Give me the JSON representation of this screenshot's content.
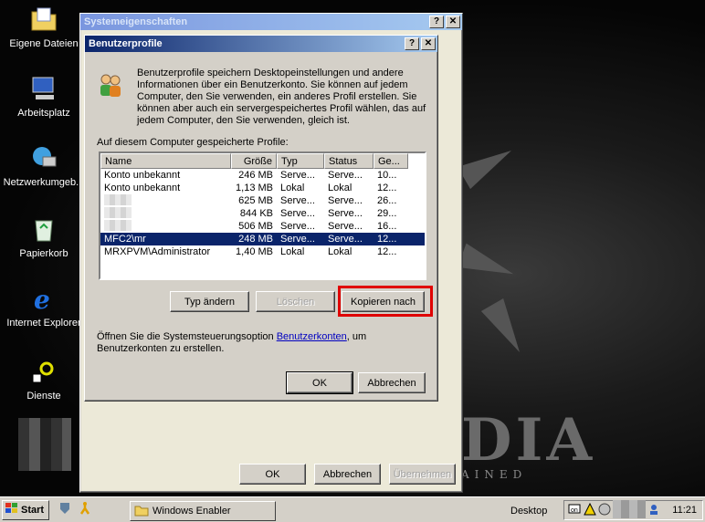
{
  "desktop": {
    "icons": [
      {
        "label": "Eigene Dateien",
        "icon": "folder-documents-icon"
      },
      {
        "label": "Arbeitsplatz",
        "icon": "my-computer-icon"
      },
      {
        "label": "Netzwerkumgeb...",
        "icon": "network-icon"
      },
      {
        "label": "Papierkorb",
        "icon": "recycle-bin-icon"
      },
      {
        "label": "Internet Explorer",
        "icon": "internet-explorer-icon"
      },
      {
        "label": "Dienste",
        "icon": "services-icon"
      }
    ],
    "wallpaper_text": "DIA",
    "wallpaper_sub": "AINED"
  },
  "outer_window": {
    "title": "Systemeigenschaften",
    "buttons": {
      "ok": "OK",
      "cancel": "Abbrechen",
      "apply": "Übernehmen"
    }
  },
  "dialog": {
    "title": "Benutzerprofile",
    "info_text": "Benutzerprofile speichern Desktopeinstellungen und andere Informationen über ein Benutzerkonto. Sie können auf jedem Computer, den Sie verwenden, ein anderes Profil erstellen. Sie können aber auch ein servergespeichertes Profil wählen, das auf jedem Computer, den Sie verwenden, gleich ist.",
    "list_label": "Auf diesem Computer gespeicherte Profile:",
    "columns": [
      "Name",
      "Größe",
      "Typ",
      "Status",
      "Ge..."
    ],
    "rows": [
      {
        "name": "Konto unbekannt",
        "size": "246 MB",
        "typ": "Serve...",
        "status": "Serve...",
        "ge": "10...",
        "blurred": false,
        "selected": false
      },
      {
        "name": "Konto unbekannt",
        "size": "1,13 MB",
        "typ": "Lokal",
        "status": "Lokal",
        "ge": "12...",
        "blurred": false,
        "selected": false
      },
      {
        "name": "",
        "size": "625 MB",
        "typ": "Serve...",
        "status": "Serve...",
        "ge": "26...",
        "blurred": true,
        "selected": false
      },
      {
        "name": "",
        "size": "844 KB",
        "typ": "Serve...",
        "status": "Serve...",
        "ge": "29...",
        "blurred": true,
        "selected": false
      },
      {
        "name": "",
        "size": "506 MB",
        "typ": "Serve...",
        "status": "Serve...",
        "ge": "16...",
        "blurred": true,
        "selected": false
      },
      {
        "name": "MFC2\\mr",
        "size": "248 MB",
        "typ": "Serve...",
        "status": "Serve...",
        "ge": "12...",
        "blurred": false,
        "selected": true
      },
      {
        "name": "MRXPVM\\Administrator",
        "size": "1,40 MB",
        "typ": "Lokal",
        "status": "Lokal",
        "ge": "12...",
        "blurred": false,
        "selected": false
      }
    ],
    "action_buttons": {
      "change_type": "Typ ändern",
      "delete": "Löschen",
      "copy_to": "Kopieren nach"
    },
    "footer_prefix": "Öffnen Sie die Systemsteuerungsoption ",
    "footer_link": "Benutzerkonten",
    "footer_suffix": ", um Benutzerkonten zu erstellen.",
    "ok": "OK",
    "cancel": "Abbrechen"
  },
  "taskbar": {
    "start": "Start",
    "task_item": "Windows Enabler",
    "desktop_label": "Desktop",
    "clock": "11:21"
  },
  "colors": {
    "highlight_box": "#e00000",
    "selection": "#0a246a",
    "link": "#0000c0"
  }
}
